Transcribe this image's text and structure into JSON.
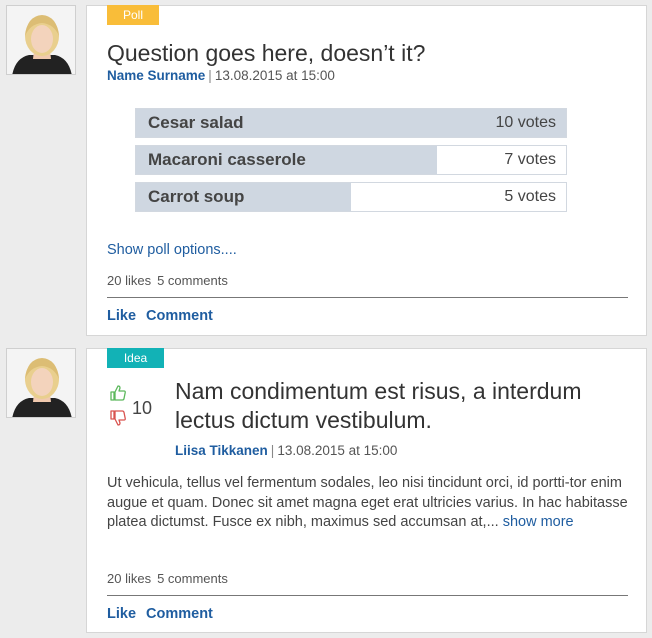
{
  "posts": [
    {
      "type_tag": "Poll",
      "question": "Question goes here, doesn’t it?",
      "author": "Name Surname",
      "separator": "|",
      "timestamp": "13.08.2015 at 15:00",
      "options": [
        {
          "label": "Cesar salad",
          "votes_text": "10 votes",
          "votes": 10
        },
        {
          "label": "Macaroni casserole",
          "votes_text": "7 votes",
          "votes": 7
        },
        {
          "label": "Carrot soup",
          "votes_text": "5 votes",
          "votes": 5
        }
      ],
      "show_options_link": "Show poll options....",
      "likes": "20 likes",
      "comments": "5 comments",
      "like_button": "Like",
      "comment_button": "Comment"
    },
    {
      "type_tag": "Idea",
      "title": "Nam condimentum est risus, a interdum lectus dictum vestibulum.",
      "vote_count": "10",
      "author": "Liisa Tikkanen",
      "separator": "|",
      "timestamp": "13.08.2015 at 15:00",
      "body": "Ut vehicula, tellus vel fermentum sodales, leo nisi tincidunt orci, id portti-tor enim augue et quam. Donec sit amet magna eget erat ultricies varius. In hac habitasse platea dictumst. Fusce ex nibh, maximus sed accumsan at,...",
      "show_more": "show more",
      "likes": "20 likes",
      "comments": "5 comments",
      "like_button": "Like",
      "comment_button": "Comment"
    }
  ],
  "colors": {
    "poll_tag": "#f9bd39",
    "idea_tag": "#12b2b6",
    "link": "#1f5da0",
    "poll_fill": "#cfd7e1",
    "thumb_up": "#5cb85c",
    "thumb_down": "#d9534f"
  },
  "icons": {
    "thumbs_up": "thumbs-up-icon",
    "thumbs_down": "thumbs-down-icon"
  }
}
